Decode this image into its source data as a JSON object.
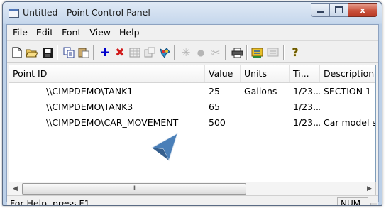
{
  "window": {
    "title": "Untitled - Point Control Panel",
    "close_glyph": "x"
  },
  "menu": [
    "File",
    "Edit",
    "Font",
    "View",
    "Help"
  ],
  "toolbar": {
    "buttons": [
      "new-document-icon",
      "open-folder-icon",
      "save-disk-icon",
      "copy-icon",
      "paste-icon",
      "add-point-icon",
      "delete-point-icon",
      "grid-icon",
      "properties-icon",
      "color-icon",
      "scan-icon",
      "record-icon",
      "cut-icon",
      "print-icon",
      "report-icon",
      "disabled-report-icon",
      "help-icon"
    ],
    "add_glyph": "+",
    "delete_glyph": "✖",
    "help_glyph": "?"
  },
  "list": {
    "columns": [
      "Point ID",
      "Value",
      "Units",
      "Ti...",
      "Description"
    ],
    "rows": [
      {
        "point_id": "\\\\CIMPDEMO\\TANK1",
        "value": "25",
        "units": "Gallons",
        "time": "1/23...",
        "description": "SECTION 1 P"
      },
      {
        "point_id": "\\\\CIMPDEMO\\TANK3",
        "value": "65",
        "units": "",
        "time": "1/23...",
        "description": ""
      },
      {
        "point_id": "\\\\CIMPDEMO\\CAR_MOVEMENT",
        "value": "500",
        "units": "",
        "time": "1/23...",
        "description": "Car model sp"
      }
    ]
  },
  "scrollbar": {
    "left_arrow": "◀",
    "right_arrow": "▶",
    "grip": "III"
  },
  "status": {
    "help_text": "For Help, press F1",
    "num": "NUM"
  },
  "colors": {
    "accent": "#0000cc",
    "delete": "#d11a1a",
    "cursor": "#4a7fb8"
  }
}
